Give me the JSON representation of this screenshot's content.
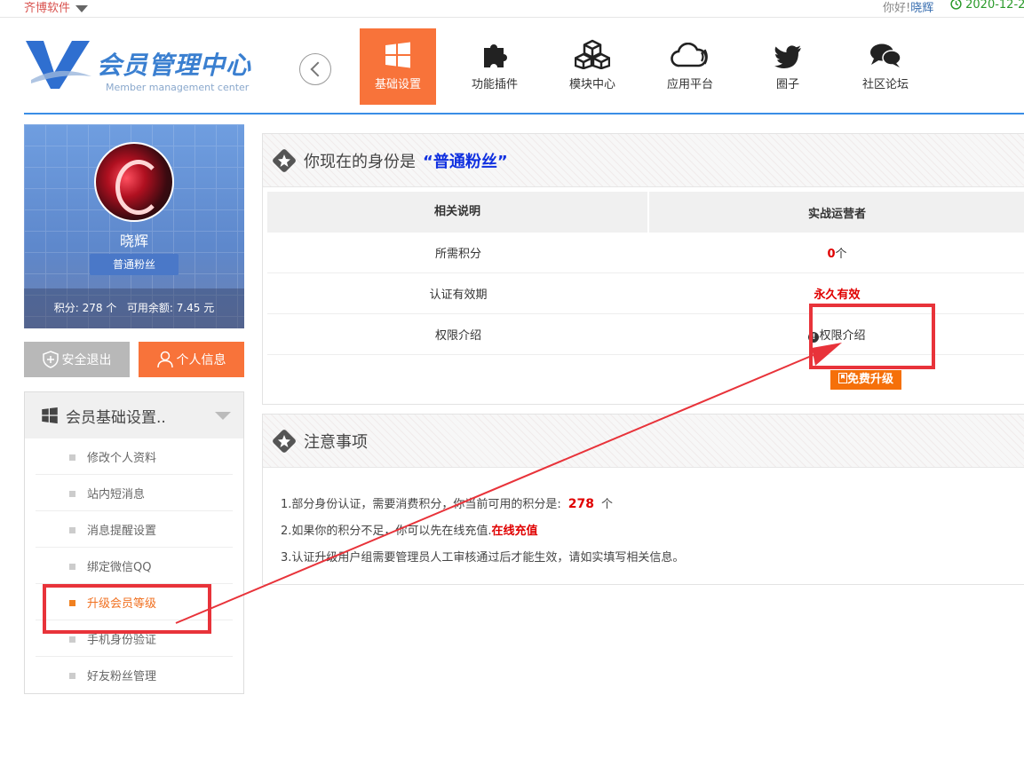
{
  "topbar": {
    "brand": "齐博软件",
    "greeting": "你好!",
    "username": "晓辉",
    "date": "2020-12-2"
  },
  "logo": {
    "title": "会员管理中心",
    "subtitle": "Member management center"
  },
  "nav": [
    {
      "label": "基础设置",
      "icon": "windows-icon",
      "active": true
    },
    {
      "label": "功能插件",
      "icon": "puzzle-icon"
    },
    {
      "label": "模块中心",
      "icon": "cubes-icon"
    },
    {
      "label": "应用平台",
      "icon": "cloud-icon"
    },
    {
      "label": "圈子",
      "icon": "twitter-bird-icon"
    },
    {
      "label": "社区论坛",
      "icon": "chat-bubbles-icon"
    }
  ],
  "profile": {
    "name": "晓辉",
    "role": "普通粉丝",
    "points_label": "积分:",
    "points": "278",
    "points_unit": "个",
    "balance_label": "可用余额:",
    "balance": "7.45",
    "balance_unit": "元"
  },
  "buttons": {
    "logout": "安全退出",
    "profile_info": "个人信息"
  },
  "side_menu": {
    "title": "会员基础设置..",
    "items": [
      "修改个人资料",
      "站内短消息",
      "消息提醒设置",
      "绑定微信QQ",
      "升级会员等级",
      "手机身份验证",
      "好友粉丝管理"
    ],
    "active_index": 4
  },
  "identity_panel": {
    "prefix": "你现在的身份是",
    "identity": "“普通粉丝”",
    "table": {
      "headers": [
        "相关说明",
        "实战运营者"
      ],
      "rows": [
        {
          "label": "所需积分",
          "value": "0",
          "unit": "个"
        },
        {
          "label": "认证有效期",
          "value": "永久有效"
        },
        {
          "label": "权限介绍",
          "value": "权限介绍"
        }
      ]
    },
    "upgrade_button": "免费升级"
  },
  "notes_panel": {
    "title": "注意事项",
    "line1_text": "1.部分身份认证，需要消费积分，你当前可用的积分是:",
    "line1_points": "278",
    "line1_unit": "个",
    "line2_text": "2.如果你的积分不足，你可以先在线充值.",
    "line2_link": "在线充值",
    "line3_text": "3.认证升级用户组需要管理员人工审核通过后才能生效，请如实填写相关信息。"
  },
  "colors": {
    "accent": "#f8733a",
    "link_blue": "#3a8ee6",
    "annotation_red": "#e8333a",
    "highlight_red": "#e00000"
  }
}
